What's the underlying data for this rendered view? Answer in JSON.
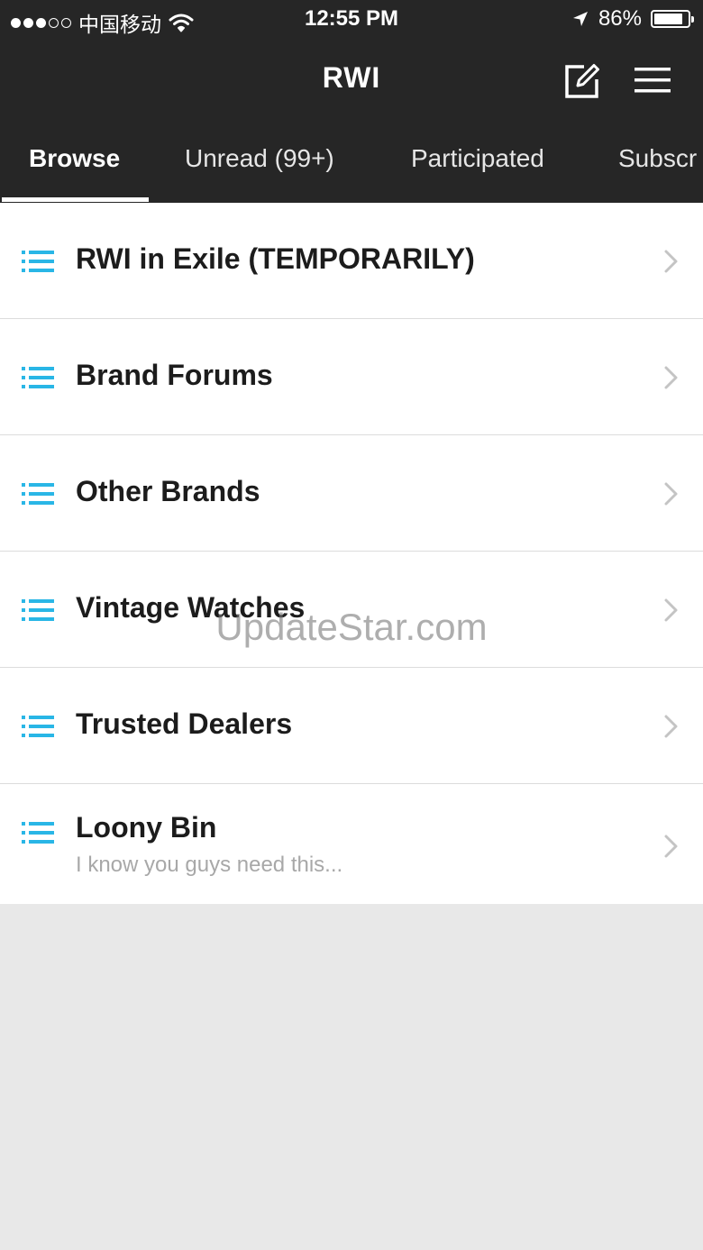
{
  "status_bar": {
    "carrier": "中国移动",
    "time": "12:55 PM",
    "battery": "86%",
    "battery_level": 0.86,
    "signal_bars_filled": 3,
    "signal_bars_total": 5,
    "icons": [
      "signal-dots-icon",
      "wifi-icon",
      "location-arrow-icon",
      "battery-icon"
    ]
  },
  "nav": {
    "title": "RWI",
    "icons": [
      "compose-icon",
      "hamburger-menu-icon"
    ]
  },
  "tabs": [
    {
      "label": "Browse",
      "active": true
    },
    {
      "label": "Unread (99+)",
      "active": false
    },
    {
      "label": "Participated",
      "active": false
    },
    {
      "label": "Subscr",
      "active": false
    }
  ],
  "forums": [
    {
      "title": "RWI in Exile (TEMPORARILY)",
      "subtitle": ""
    },
    {
      "title": "Brand Forums",
      "subtitle": ""
    },
    {
      "title": "Other Brands",
      "subtitle": ""
    },
    {
      "title": "Vintage Watches",
      "subtitle": ""
    },
    {
      "title": "Trusted Dealers",
      "subtitle": ""
    },
    {
      "title": "Loony Bin",
      "subtitle": "I know you guys need this..."
    }
  ],
  "watermark": "UpdateStar.com",
  "colors": {
    "header_bg": "#262626",
    "accent_icon": "#29b6e6",
    "list_bg": "#ffffff",
    "empty_bg": "#e8e8e8",
    "title_text": "#1c1c1c",
    "subtitle_text": "#a8a8a8",
    "chevron": "#c4c4c4"
  }
}
